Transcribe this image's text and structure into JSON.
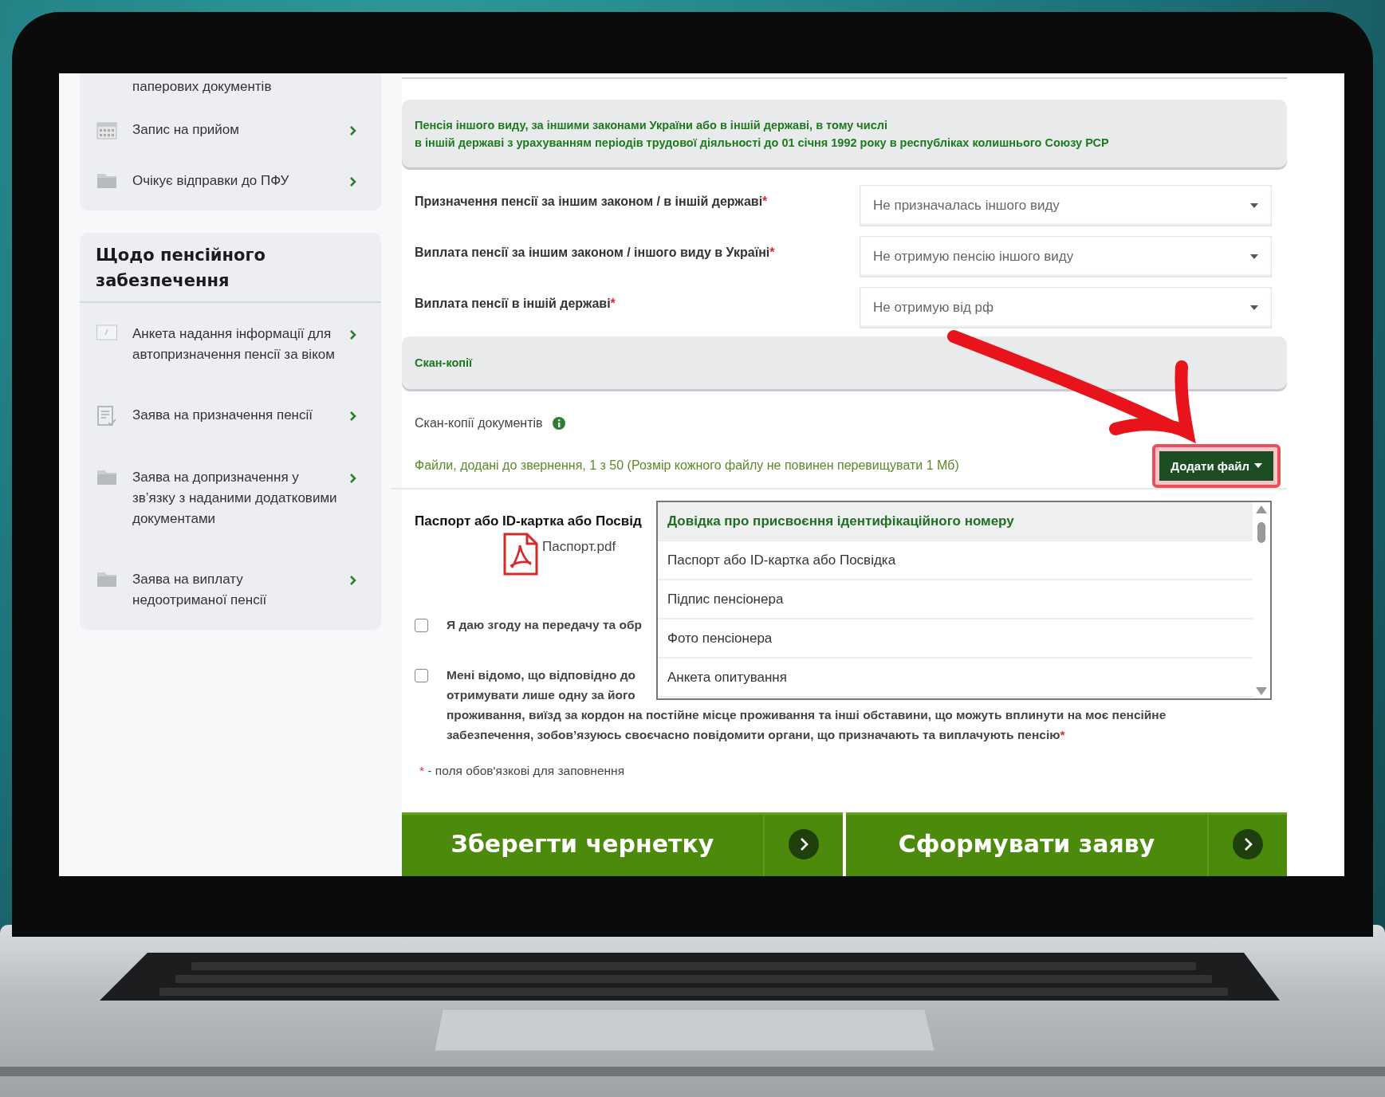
{
  "sidebar": {
    "groups": [
      {
        "items": [
          {
            "label": "паперових документів",
            "kind": "cut"
          },
          {
            "label": "Запис на прийом",
            "kind": "calendar"
          },
          {
            "label": "Очікує відправки до ПФУ",
            "kind": "folder"
          }
        ]
      },
      {
        "title": "Щодо пенсійного забезпечення",
        "items": [
          {
            "label": "Анкета надання інформації для автопризначення пенсії за віком",
            "kind": "form"
          },
          {
            "label": "Заява на призначення пенсії",
            "kind": "checklist"
          },
          {
            "label": "Заява на допризначення у зв’язку з наданими додатковими документами",
            "kind": "folder"
          },
          {
            "label": "Заява на виплату недоотриманої пенсії",
            "kind": "folder"
          }
        ]
      }
    ]
  },
  "main": {
    "section_header": [
      "Пенсія іншого виду, за іншими законами України або в іншій державі, в тому числі",
      "в іншій державі з урахуванням періодів трудової діяльності до 01 січня 1992 року в республіках колишнього Союзу РСР"
    ],
    "fields": [
      {
        "label": "Призначення пенсії за іншим законом / в іншій державі",
        "mark": "*",
        "value": "Не призначалась іншого виду"
      },
      {
        "label": "Виплата пенсії за іншим законом / іншого виду в Україні",
        "mark": "*",
        "value": "Не отримую пенсію іншого виду"
      },
      {
        "label": "Виплата пенсії в іншій державі",
        "mark": "*",
        "value": "Не отримую від рф"
      }
    ],
    "scan_header": "Скан-копії",
    "scan_label": "Скан-копії документів",
    "files_note": "Файли, додані до звернення, 1 з 50 (Розмір кожного файлу не повинен перевищувати 1 Мб)",
    "add_button": {
      "label": "Додати файл",
      "highlighted": true
    },
    "menu": [
      {
        "label": "Довідка про присвоєння ідентифікаційного номеру",
        "selected": true
      },
      {
        "label": "Паспорт або ID-картка або Посвідка",
        "selected": false
      },
      {
        "label": "Підпис пенсіонера",
        "selected": false
      },
      {
        "label": "Фото пенсіонера",
        "selected": false
      },
      {
        "label": "Анкета опитування",
        "selected": false
      }
    ],
    "document": {
      "heading": "Паспорт або ID-картка або Посвід",
      "file": "Паспорт.pdf"
    },
    "consents": [
      {
        "checked": false,
        "lines": [
          "Я даю згоду на передачу та обр"
        ]
      },
      {
        "checked": false,
        "lines": [
          "Мені відомо, що відповідно до",
          "отримувати лише одну за його",
          "проживання, виїзд за кордон на постійне місце проживання та інші обставини, що можуть вплинути на моє пенсійне",
          "забезпечення, зобов’язуюсь своєчасно повідомити органи, що призначають та виплачують пенсію"
        ],
        "mark": "*"
      }
    ],
    "required_note": {
      "mark": "*",
      "text": " - поля обов'язкові для заповнення"
    },
    "actions": [
      {
        "label": "Зберегти чернетку"
      },
      {
        "label": "Сформувати заяву"
      }
    ]
  }
}
